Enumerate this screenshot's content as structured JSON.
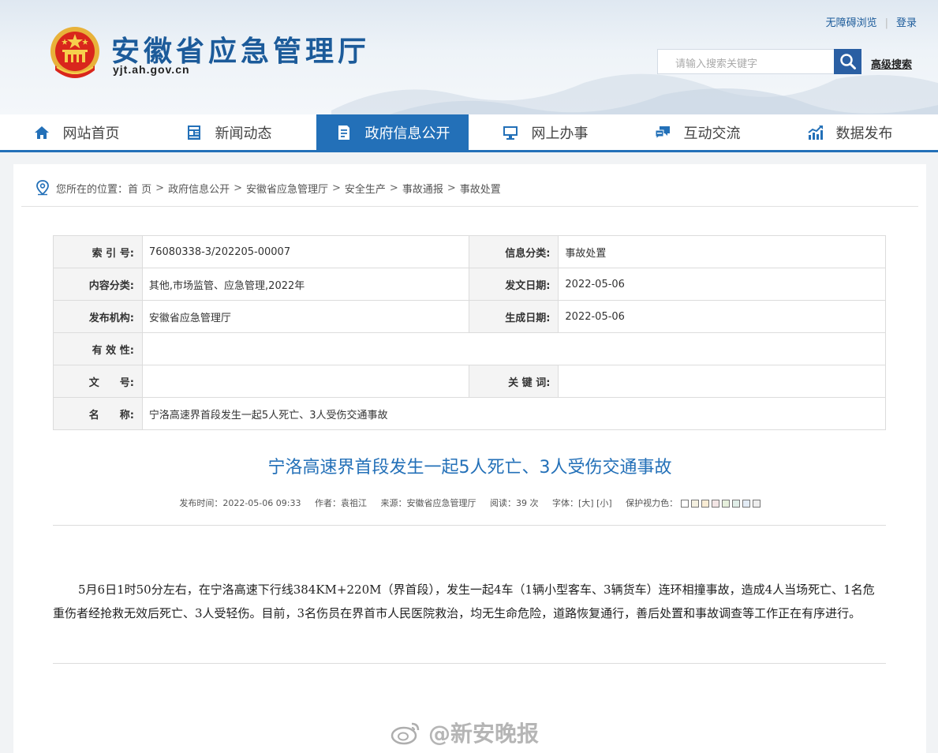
{
  "header": {
    "site_title": "安徽省应急管理厅",
    "site_domain": "yjt.ah.gov.cn",
    "links": {
      "accessible": "无障碍浏览",
      "login": "登录"
    },
    "search": {
      "placeholder": "请输入搜索关键字",
      "advanced": "高级搜索"
    }
  },
  "nav": {
    "items": [
      {
        "label": "网站首页",
        "icon": "home-icon"
      },
      {
        "label": "新闻动态",
        "icon": "news-icon"
      },
      {
        "label": "政府信息公开",
        "icon": "document-icon",
        "active": true
      },
      {
        "label": "网上办事",
        "icon": "monitor-icon"
      },
      {
        "label": "互动交流",
        "icon": "chat-icon"
      },
      {
        "label": "数据发布",
        "icon": "chart-icon"
      }
    ],
    "active_color": "#2370b8"
  },
  "breadcrumb": {
    "prefix": "您所在的位置：",
    "items": [
      "首 页",
      "政府信息公开",
      "安徽省应急管理厅",
      "安全生产",
      "事故通报",
      "事故处置"
    ]
  },
  "meta": {
    "index_label": "索 引 号:",
    "index_value": "76080338-3/202205-00007",
    "category_label": "信息分类:",
    "category_value": "事故处置",
    "content_label": "内容分类:",
    "content_value": "其他,市场监管、应急管理,2022年",
    "date_label": "发文日期:",
    "date_value": "2022-05-06",
    "org_label": "发布机构:",
    "org_value": "安徽省应急管理厅",
    "created_label": "生成日期:",
    "created_value": "2022-05-06",
    "validity_label": "有 效 性:",
    "validity_value": "",
    "docno_label": "文　　号:",
    "docno_value": "",
    "keywords_label": "关 键 词:",
    "keywords_value": "",
    "name_label": "名　　称:",
    "name_value": "宁洛高速界首段发生一起5人死亡、3人受伤交通事故"
  },
  "article": {
    "title": "宁洛高速界首段发生一起5人死亡、3人受伤交通事故",
    "publish_time": "发布时间：2022-05-06 09:33",
    "author": "作者：袁祖江",
    "source": "来源：安徽省应急管理厅",
    "reads": "阅读：39 次",
    "font_label": "字体：",
    "font_large": "[大]",
    "font_small": "[小]",
    "eye_color_label": "保护视力色：",
    "eye_colors": [
      "#ffffff",
      "#f4f0e0",
      "#f9ecd4",
      "#f3e5e5",
      "#e6f0dc",
      "#e0eee8",
      "#e3ecf6",
      "#eeeeee"
    ],
    "body": "5月6日1时50分左右，在宁洛高速下行线384KM+220M（界首段），发生一起4车（1辆小型客车、3辆货车）连环相撞事故，造成4人当场死亡、1名危重伤者经抢救无效后死亡、3人受轻伤。目前，3名伤员在界首市人民医院救治，均无生命危险，道路恢复通行，善后处置和事故调查等工作正在有序进行。"
  },
  "watermark": {
    "text": "@新安晚报",
    "icon": "weibo-icon"
  }
}
